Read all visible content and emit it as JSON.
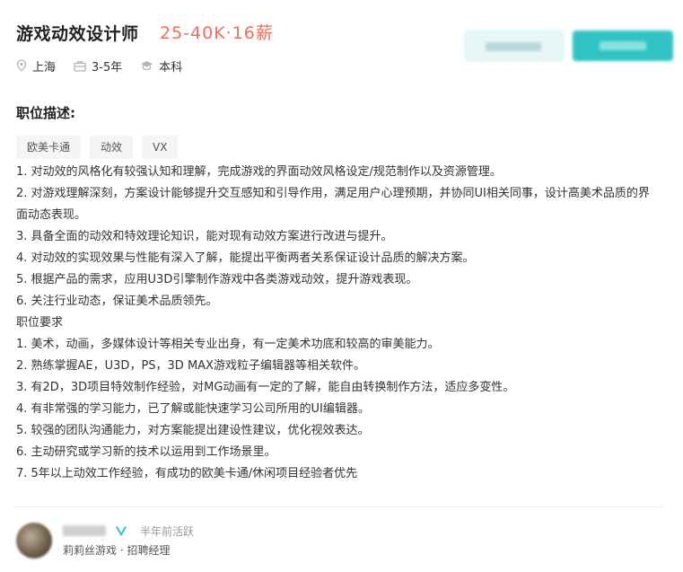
{
  "job": {
    "title": "游戏动效设计师",
    "salary": "25-40K·16薪",
    "location": "上海",
    "experience": "3-5年",
    "education": "本科"
  },
  "section": {
    "description_title": "职位描述:"
  },
  "tags": [
    "欧美卡通",
    "动效",
    "VX"
  ],
  "description_lines": [
    "1. 对动效的风格化有较强认知和理解，完成游戏的界面动效风格设定/规范制作以及资源管理。",
    "2. 对游戏理解深刻，方案设计能够提升交互感知和引导作用，满足用户心理预期，并协同UI相关同事，设计高美术品质的界面动态表现。",
    "3. 具备全面的动效和特效理论知识，能对现有动效方案进行改进与提升。",
    "4. 对动效的实现效果与性能有深入了解，能提出平衡两者关系保证设计品质的解决方案。",
    "5. 根据产品的需求，应用U3D引擎制作游戏中各类游戏动效，提升游戏表现。",
    "6. 关注行业动态，保证美术品质领先。",
    "职位要求",
    "1. 美术，动画，多媒体设计等相关专业出身，有一定美术功底和较高的审美能力。",
    "2. 熟练掌握AE，U3D，PS，3D MAX游戏粒子编辑器等相关软件。",
    "3. 有2D，3D项目特效制作经验，对MG动画有一定的了解，能自由转换制作方法，适应多变性。",
    "4. 有非常强的学习能力，已了解或能快速学习公司所用的UI编辑器。",
    "5. 较强的团队沟通能力，对方案能提出建设性建议，优化视效表达。",
    "6. 主动研究或学习新的技术以运用到工作场景里。",
    "7. 5年以上动效工作经验，有成功的欧美卡通/休闲项目经验者优先"
  ],
  "recruiter": {
    "active_status": "半年前活跃",
    "company_role": "莉莉丝游戏 · 招聘经理"
  },
  "colors": {
    "salary": "#f26d5b",
    "accent": "#2fc3c3",
    "verified": "#3fc6c6"
  }
}
